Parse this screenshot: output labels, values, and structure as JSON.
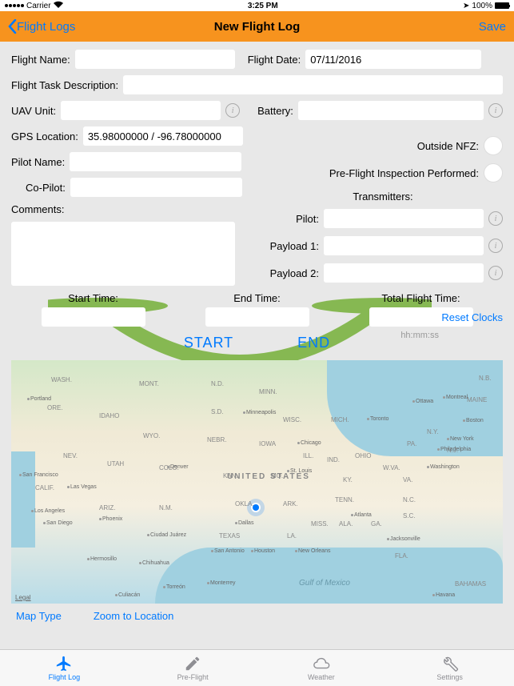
{
  "status": {
    "carrier": "Carrier",
    "time": "3:25 PM",
    "battery": "100%"
  },
  "nav": {
    "back": "Flight Logs",
    "title": "New Flight Log",
    "save": "Save"
  },
  "form": {
    "flight_name_label": "Flight Name:",
    "flight_date_label": "Flight Date:",
    "flight_date_value": "07/11/2016",
    "task_desc_label": "Flight Task Description:",
    "uav_unit_label": "UAV Unit:",
    "battery_label": "Battery:",
    "gps_label": "GPS Location:",
    "gps_value": "35.98000000 / -96.78000000",
    "outside_nfz_label": "Outside NFZ:",
    "preflight_label": "Pre-Flight Inspection Performed:",
    "pilot_name_label": "Pilot Name:",
    "copilot_label": "Co-Pilot:",
    "comments_label": "Comments:",
    "transmitters_label": "Transmitters:",
    "tx_pilot_label": "Pilot:",
    "tx_payload1_label": "Payload 1:",
    "tx_payload2_label": "Payload 2:",
    "start_time_label": "Start Time:",
    "end_time_label": "End Time:",
    "total_time_label": "Total Flight Time:",
    "reset_clocks": "Reset Clocks",
    "hhmmss": "hh:mm:ss",
    "start_btn": "START",
    "end_btn": "END"
  },
  "map": {
    "legal": "Legal",
    "gulf": "Gulf of Mexico",
    "us": "UNITED STATES",
    "map_type": "Map Type",
    "zoom": "Zoom to Location",
    "labels": {
      "wash": "WASH.",
      "mont": "MONT.",
      "nd": "N.D.",
      "minn": "MINN.",
      "ore": "ORE.",
      "idaho": "IDAHO",
      "sd": "S.D.",
      "wisc": "WISC.",
      "mich": "MICH.",
      "wyo": "WYO.",
      "iowa": "IOWA",
      "ill": "ILL.",
      "ind": "IND.",
      "ohio": "OHIO",
      "nev": "NEV.",
      "utah": "UTAH",
      "colo": "COLO.",
      "nebr": "NEBR.",
      "kan": "KAN.",
      "mo": "MO.",
      "ky": "KY.",
      "calif": "CALIF.",
      "ariz": "ARIZ.",
      "nm": "N.M.",
      "okla": "OKLA.",
      "ark": "ARK.",
      "tenn": "TENN.",
      "nc": "N.C.",
      "texas": "TEXAS",
      "la": "LA.",
      "miss": "MISS.",
      "ala": "ALA.",
      "ga": "GA.",
      "sc": "S.C.",
      "fla": "FLA.",
      "maine": "MAINE",
      "ny": "N.Y.",
      "pa": "PA.",
      "va": "VA.",
      "wva": "W.VA.",
      "nj": "N.J.",
      "nb": "N.B.",
      "bahamas": "BAHAMAS"
    },
    "cities": {
      "portland": "Portland",
      "minneapolis": "Minneapolis",
      "toronto": "Toronto",
      "boston": "Boston",
      "ny": "New York",
      "phil": "Philadelphia",
      "denver": "Denver",
      "chicago": "Chicago",
      "stlouis": "St. Louis",
      "washington": "Washington",
      "sf": "San Francisco",
      "lv": "Las Vegas",
      "la": "Los Angeles",
      "sd": "San Diego",
      "phoenix": "Phoenix",
      "dallas": "Dallas",
      "atlanta": "Atlanta",
      "jax": "Jacksonville",
      "cj": "Ciudad Juárez",
      "sa": "San Antonio",
      "houston": "Houston",
      "no": "New Orleans",
      "hermosillo": "Hermosillo",
      "chihuahua": "Chihuahua",
      "torreon": "Torreón",
      "monterrey": "Monterrey",
      "culiacan": "Culiacán",
      "havana": "Havana",
      "ottawa": "Ottawa",
      "montreal": "Montreal"
    }
  },
  "tabs": {
    "flight_log": "Flight Log",
    "pre_flight": "Pre-Flight",
    "weather": "Weather",
    "settings": "Settings"
  }
}
